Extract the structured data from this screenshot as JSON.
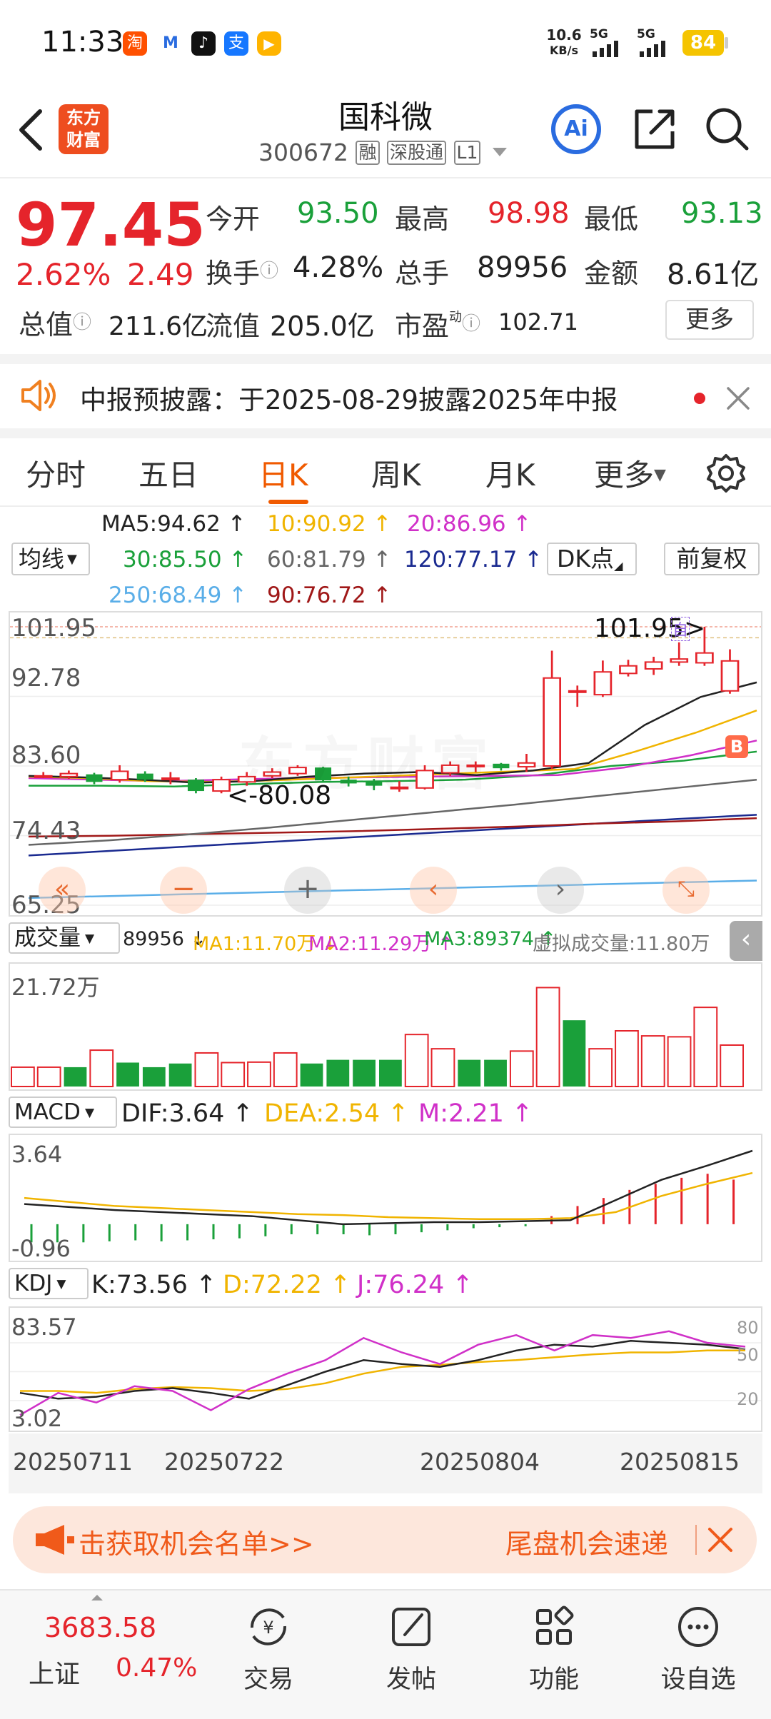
{
  "status_bar": {
    "time": "11:33",
    "net_speed_value": "10.6",
    "net_speed_unit": "KB/s",
    "sig1": "5G",
    "sig2": "5G",
    "battery": "84"
  },
  "header": {
    "brand_line1": "东方",
    "brand_line2": "财富",
    "stock_name": "国科微",
    "stock_code": "300672",
    "badge_rong": "融",
    "badge_sgt": "深股通",
    "badge_l1": "L1",
    "ai_label": "Ai"
  },
  "quote": {
    "price": "97.45",
    "change_pct": "2.62%",
    "change_amt": "2.49",
    "open_label": "今开",
    "open_value": "93.50",
    "high_label": "最高",
    "high_value": "98.98",
    "low_label": "最低",
    "low_value": "93.13",
    "turnover_label": "换手",
    "turnover_value": "4.28%",
    "volume_label": "总手",
    "volume_value": "89956",
    "amount_label": "金额",
    "amount_value": "8.61亿",
    "mktcap_label": "总值",
    "mktcap_value": "211.6亿",
    "float_label": "流值",
    "float_value": "205.0亿",
    "pe_label": "市盈",
    "pe_sup": "动",
    "pe_value": "102.71",
    "more_label": "更多"
  },
  "notice": {
    "text": "中报预披露：于2025-08-29披露2025年中报"
  },
  "tabs": [
    {
      "label": "分时"
    },
    {
      "label": "五日"
    },
    {
      "label": "日K"
    },
    {
      "label": "周K"
    },
    {
      "label": "月K"
    },
    {
      "label": "更多"
    }
  ],
  "active_tab": 2,
  "ma": {
    "selector": "均线",
    "ma5": "MA5:94.62 ↑",
    "ma10": "10:90.92 ↑",
    "ma20": "20:86.96 ↑",
    "ma30": "30:85.50 ↑",
    "ma60": "60:81.79 ↑",
    "ma120": "120:77.17 ↑",
    "ma250": "250:68.49 ↑",
    "ma90": "90:76.72 ↑",
    "dk": "DK点",
    "fq": "前复权"
  },
  "price_chart": {
    "y_labels": [
      "101.95",
      "92.78",
      "83.60",
      "74.43",
      "65.25"
    ],
    "high_mark": "101.95>",
    "low_mark": "<-80.08",
    "b_mark": "B",
    "zi_mark": "自"
  },
  "chart_data": {
    "type": "candlestick",
    "ylim": [
      65.25,
      101.95
    ],
    "x_ticks": [
      "20250711",
      "20250722",
      "20250804",
      "20250815"
    ],
    "candles": [
      {
        "o": 82.3,
        "c": 82.3,
        "h": 82.8,
        "l": 82.0
      },
      {
        "o": 82.2,
        "c": 82.6,
        "h": 83.0,
        "l": 81.9
      },
      {
        "o": 82.5,
        "c": 81.5,
        "h": 82.7,
        "l": 81.2
      },
      {
        "o": 81.8,
        "c": 82.9,
        "h": 83.7,
        "l": 81.4
      },
      {
        "o": 82.6,
        "c": 81.8,
        "h": 82.9,
        "l": 81.5
      },
      {
        "o": 82.0,
        "c": 82.0,
        "h": 82.8,
        "l": 81.2
      },
      {
        "o": 81.8,
        "c": 80.3,
        "h": 82.0,
        "l": 80.0
      },
      {
        "o": 80.3,
        "c": 81.8,
        "h": 82.2,
        "l": 80.0
      },
      {
        "o": 81.5,
        "c": 82.2,
        "h": 82.8,
        "l": 81.0
      },
      {
        "o": 82.3,
        "c": 82.8,
        "h": 83.3,
        "l": 82.0
      },
      {
        "o": 82.6,
        "c": 83.4,
        "h": 83.7,
        "l": 82.3
      },
      {
        "o": 83.4,
        "c": 81.7,
        "h": 83.5,
        "l": 81.5
      },
      {
        "o": 81.8,
        "c": 81.3,
        "h": 82.2,
        "l": 80.9
      },
      {
        "o": 81.6,
        "c": 81.0,
        "h": 81.9,
        "l": 80.4
      },
      {
        "o": 80.8,
        "c": 80.8,
        "h": 81.6,
        "l": 80.2
      },
      {
        "o": 80.7,
        "c": 83.0,
        "h": 83.7,
        "l": 80.5
      },
      {
        "o": 82.7,
        "c": 83.7,
        "h": 84.2,
        "l": 82.3
      },
      {
        "o": 83.7,
        "c": 83.7,
        "h": 84.2,
        "l": 82.8
      },
      {
        "o": 83.9,
        "c": 83.3,
        "h": 84.0,
        "l": 83.0
      },
      {
        "o": 83.5,
        "c": 84.0,
        "h": 85.2,
        "l": 82.8
      },
      {
        "o": 83.6,
        "c": 95.2,
        "h": 98.8,
        "l": 83.2
      },
      {
        "o": 93.5,
        "c": 93.5,
        "h": 94.2,
        "l": 91.4
      },
      {
        "o": 93.0,
        "c": 96.0,
        "h": 97.5,
        "l": 92.7
      },
      {
        "o": 95.8,
        "c": 96.8,
        "h": 97.6,
        "l": 95.4
      },
      {
        "o": 96.4,
        "c": 97.3,
        "h": 98.0,
        "l": 95.6
      },
      {
        "o": 97.3,
        "c": 97.7,
        "h": 99.9,
        "l": 96.8
      },
      {
        "o": 97.2,
        "c": 98.5,
        "h": 101.95,
        "l": 96.8
      },
      {
        "o": 93.5,
        "c": 97.45,
        "h": 98.98,
        "l": 93.13
      }
    ]
  },
  "volume": {
    "selector": "成交量",
    "vol": "89956 ↓",
    "ma1": "MA1:11.70万 ↓",
    "ma2": "MA2:11.29万 ↑",
    "ma3": "MA3:89374 ↑",
    "virtual": "虚拟成交量:11.80万",
    "y_label": "21.72万",
    "values": [
      4.2,
      4.2,
      4.2,
      7.9,
      5.2,
      4.2,
      5.0,
      7.3,
      5.2,
      5.3,
      7.3,
      5.0,
      5.8,
      5.8,
      5.8,
      11.3,
      8.2,
      5.8,
      5.8,
      7.7,
      21.5,
      14.4,
      8.2,
      12.1,
      11.0,
      10.8,
      17.2,
      9.0
    ],
    "up": [
      true,
      true,
      false,
      true,
      false,
      false,
      false,
      true,
      true,
      true,
      true,
      false,
      false,
      false,
      false,
      true,
      true,
      false,
      false,
      true,
      true,
      false,
      true,
      true,
      true,
      true,
      true,
      true
    ]
  },
  "macd": {
    "selector": "MACD",
    "dif": "DIF:3.64 ↑",
    "dea": "DEA:2.54 ↑",
    "m": "M:2.21 ↑",
    "y_top": "3.64",
    "y_bottom": "-0.96",
    "m_values": [
      -0.9,
      -0.9,
      -0.9,
      -0.85,
      -0.8,
      -0.85,
      -0.8,
      -0.75,
      -0.7,
      -0.6,
      -0.5,
      -0.5,
      -0.5,
      -0.55,
      -0.5,
      -0.4,
      -0.3,
      -0.2,
      -0.15,
      -0.1,
      0.4,
      0.9,
      1.3,
      1.7,
      2.0,
      2.3,
      2.5,
      2.21
    ]
  },
  "kdj": {
    "selector": "KDJ",
    "k": "K:73.56 ↑",
    "d": "D:72.22 ↑",
    "j": "J:76.24 ↑",
    "y_top": "83.57",
    "y_bottom": "3.02",
    "right_80": "80",
    "right_50": "50",
    "right_20": "20"
  },
  "banner": {
    "left": "击获取机会名单>>",
    "right": "尾盘机会速递"
  },
  "bottom_bar": {
    "index_value": "3683.58",
    "index_name": "上证",
    "index_change": "0.47%",
    "items": [
      {
        "label": "交易"
      },
      {
        "label": "发帖"
      },
      {
        "label": "功能"
      },
      {
        "label": "设自选"
      }
    ]
  },
  "colors": {
    "up": "#e5242b",
    "down": "#1aa03a",
    "accent": "#ff6600",
    "ma5": "#222222",
    "ma10": "#f0b400",
    "ma20": "#d030c8",
    "ma30": "#1aa03a",
    "ma60": "#666666",
    "ma120": "#1a2a90",
    "ma250": "#5aaee8",
    "ma90": "#a01818"
  }
}
